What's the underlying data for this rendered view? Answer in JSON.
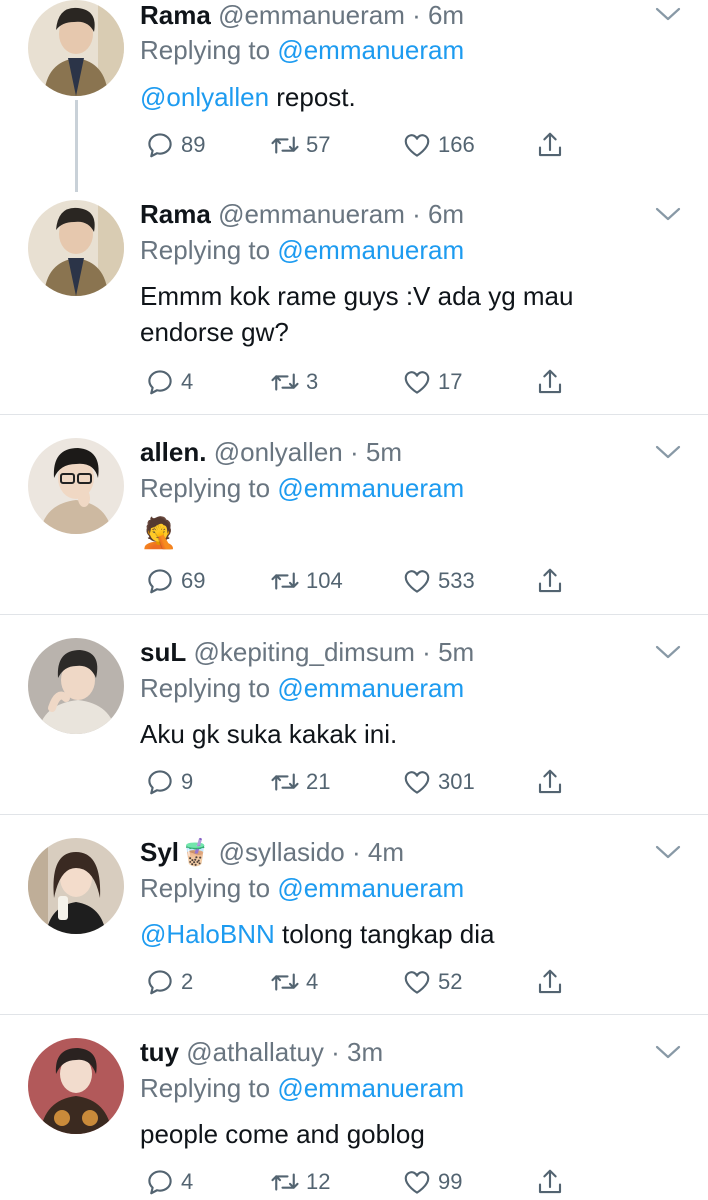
{
  "tweets": [
    {
      "name": "Rama",
      "handle": "@emmanueram",
      "time": "6m",
      "reply_prefix": "Replying to",
      "reply_to": "@emmanueram",
      "mention": "@onlyallen",
      "text": " repost.",
      "replies": "89",
      "retweets": "57",
      "likes": "166",
      "avatar": "avatar-rama"
    },
    {
      "name": "Rama",
      "handle": "@emmanueram",
      "time": "6m",
      "reply_prefix": "Replying to",
      "reply_to": "@emmanueram",
      "mention": "",
      "text": "Emmm kok rame guys :V ada yg mau endorse gw?",
      "replies": "4",
      "retweets": "3",
      "likes": "17",
      "avatar": "avatar-rama"
    },
    {
      "name": "allen.",
      "handle": "@onlyallen",
      "time": "5m",
      "reply_prefix": "Replying to",
      "reply_to": "@emmanueram",
      "mention": "",
      "text": "🤦",
      "replies": "69",
      "retweets": "104",
      "likes": "533",
      "avatar": "avatar-allen"
    },
    {
      "name": "suL",
      "handle": "@kepiting_dimsum",
      "time": "5m",
      "reply_prefix": "Replying to",
      "reply_to": "@emmanueram",
      "mention": "",
      "text": "Aku gk suka kakak ini.",
      "replies": "9",
      "retweets": "21",
      "likes": "301",
      "avatar": "avatar-sul"
    },
    {
      "name": "Syl",
      "name_emoji": "🧋",
      "handle": "@syllasido",
      "time": "4m",
      "reply_prefix": "Replying to",
      "reply_to": "@emmanueram",
      "mention": "@HaloBNN",
      "text": " tolong tangkap dia",
      "replies": "2",
      "retweets": "4",
      "likes": "52",
      "avatar": "avatar-syl"
    },
    {
      "name": "tuy",
      "handle": "@athallatuy",
      "time": "3m",
      "reply_prefix": "Replying to",
      "reply_to": "@emmanueram",
      "mention": "",
      "text": "people come and goblog",
      "replies": "4",
      "retweets": "12",
      "likes": "99",
      "avatar": "avatar-tuy"
    }
  ],
  "separator": " · ",
  "colors": {
    "link": "#1d9bf0",
    "muted": "#697580",
    "divider": "#e1e4e8",
    "thread_line": "#c9d1d8"
  },
  "icons": [
    "reply-icon",
    "retweet-icon",
    "like-icon",
    "share-icon",
    "chevron-down-icon"
  ]
}
